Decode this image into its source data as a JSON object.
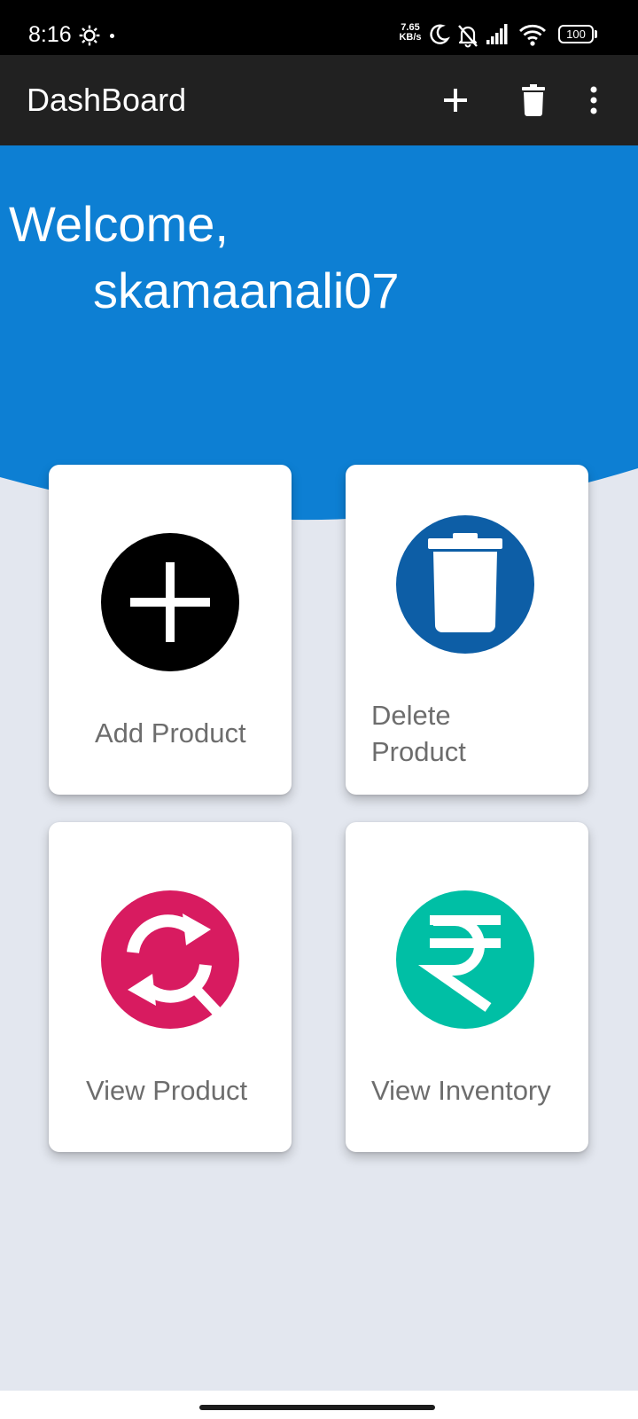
{
  "status_bar": {
    "time": "8:16",
    "net_speed_value": "7.65",
    "net_speed_unit": "KB/s",
    "battery": "100",
    "icons": [
      "settings-gear-icon",
      "moon-icon",
      "bell-off-icon",
      "signal-icon",
      "wifi-icon",
      "battery-icon"
    ]
  },
  "app_bar": {
    "title": "DashBoard",
    "actions": [
      "add-icon",
      "delete-icon",
      "overflow-menu-icon"
    ]
  },
  "hero": {
    "greeting": "Welcome,",
    "username": "skamaanali07"
  },
  "cards": [
    {
      "label": "Add Product",
      "icon": "add-circle-icon",
      "icon_color": "#000000"
    },
    {
      "label": "Delete Product",
      "label_lines": [
        "Delete",
        "Product"
      ],
      "icon": "trash-circle-icon",
      "icon_color": "#0d5ea6"
    },
    {
      "label": "View Product",
      "icon": "sync-search-icon",
      "icon_color": "#d81b60"
    },
    {
      "label": "View Inventory",
      "icon": "rupee-circle-icon",
      "icon_color": "#00bfa5"
    }
  ],
  "colors": {
    "app_bar": "#212121",
    "hero": "#0d7fd3",
    "background": "#e3e7ef",
    "card_label": "#6d6d6d"
  }
}
